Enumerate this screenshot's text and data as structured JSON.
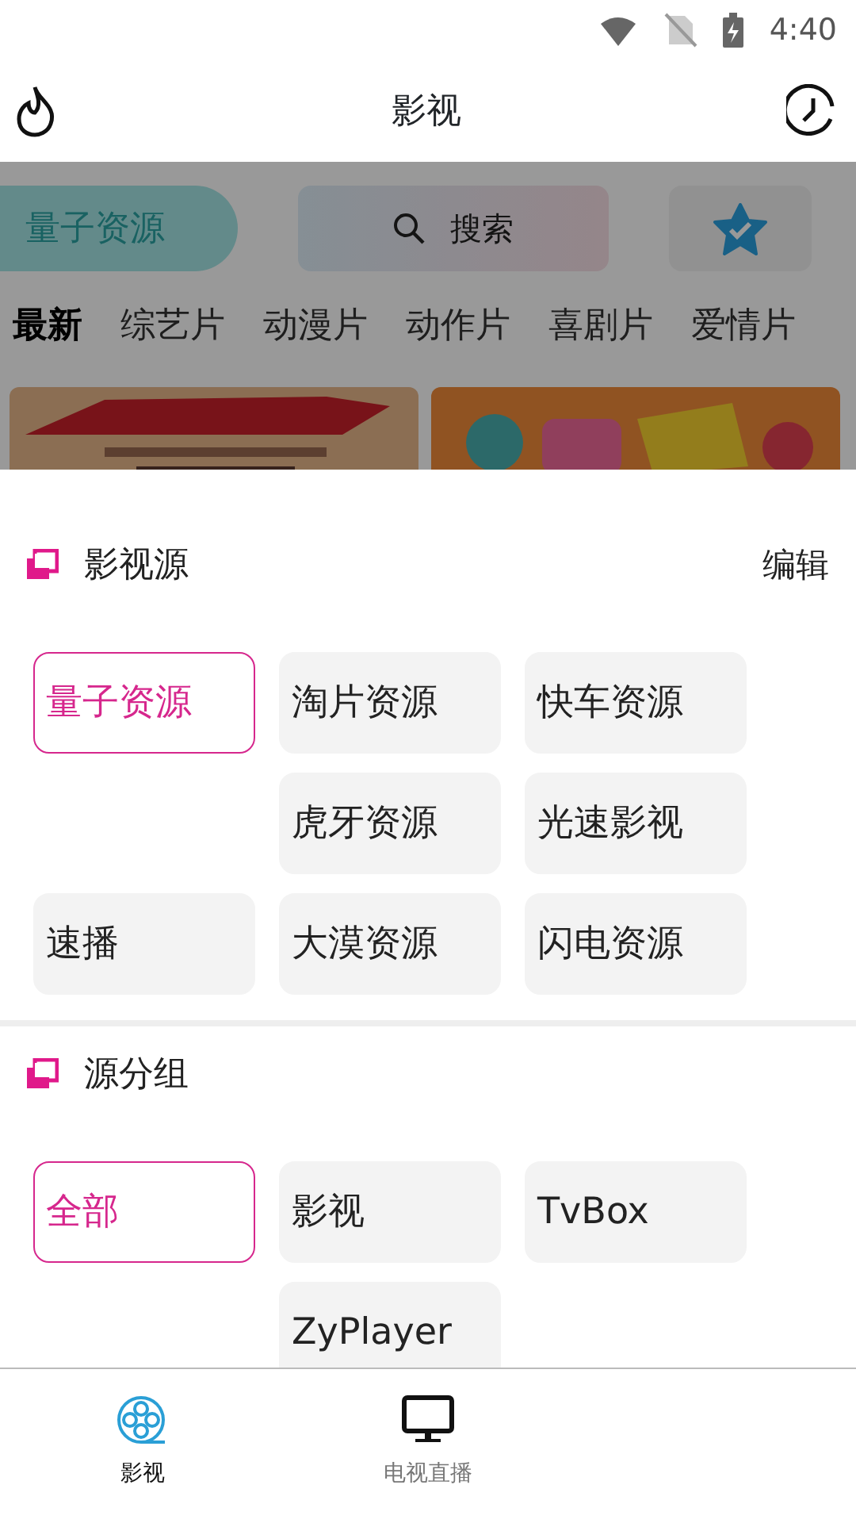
{
  "status_bar": {
    "time": "4:40"
  },
  "app_bar": {
    "title": "影视"
  },
  "background": {
    "source_button": "量子资源",
    "search": {
      "placeholder": "搜索"
    },
    "categories": [
      {
        "label": "最新",
        "selected": true
      },
      {
        "label": "综艺片",
        "selected": false
      },
      {
        "label": "动漫片",
        "selected": false
      },
      {
        "label": "动作片",
        "selected": false
      },
      {
        "label": "喜剧片",
        "selected": false
      },
      {
        "label": "爱情片",
        "selected": false
      }
    ]
  },
  "sheet": {
    "sections": [
      {
        "title": "影视源",
        "action": "编辑",
        "rows": [
          {
            "indent": false,
            "items": [
              {
                "label": "量子资源",
                "selected": true
              },
              {
                "label": "淘片资源",
                "selected": false
              },
              {
                "label": "快车资源",
                "selected": false
              }
            ]
          },
          {
            "indent": true,
            "items": [
              {
                "label": "虎牙资源",
                "selected": false
              },
              {
                "label": "光速影视",
                "selected": false
              }
            ]
          },
          {
            "indent": false,
            "items": [
              {
                "label": "速播",
                "selected": false
              },
              {
                "label": "大漠资源",
                "selected": false
              },
              {
                "label": "闪电资源",
                "selected": false
              }
            ]
          }
        ]
      },
      {
        "title": "源分组",
        "rows": [
          {
            "indent": false,
            "items": [
              {
                "label": "全部",
                "selected": true
              },
              {
                "label": "影视",
                "selected": false
              },
              {
                "label": "TvBox",
                "selected": false
              }
            ]
          },
          {
            "indent": true,
            "items": [
              {
                "label": "ZyPlayer",
                "selected": false
              }
            ]
          }
        ]
      }
    ]
  },
  "bottom_nav": [
    {
      "label": "影视",
      "selected": true
    },
    {
      "label": "电视直播",
      "selected": false
    }
  ]
}
